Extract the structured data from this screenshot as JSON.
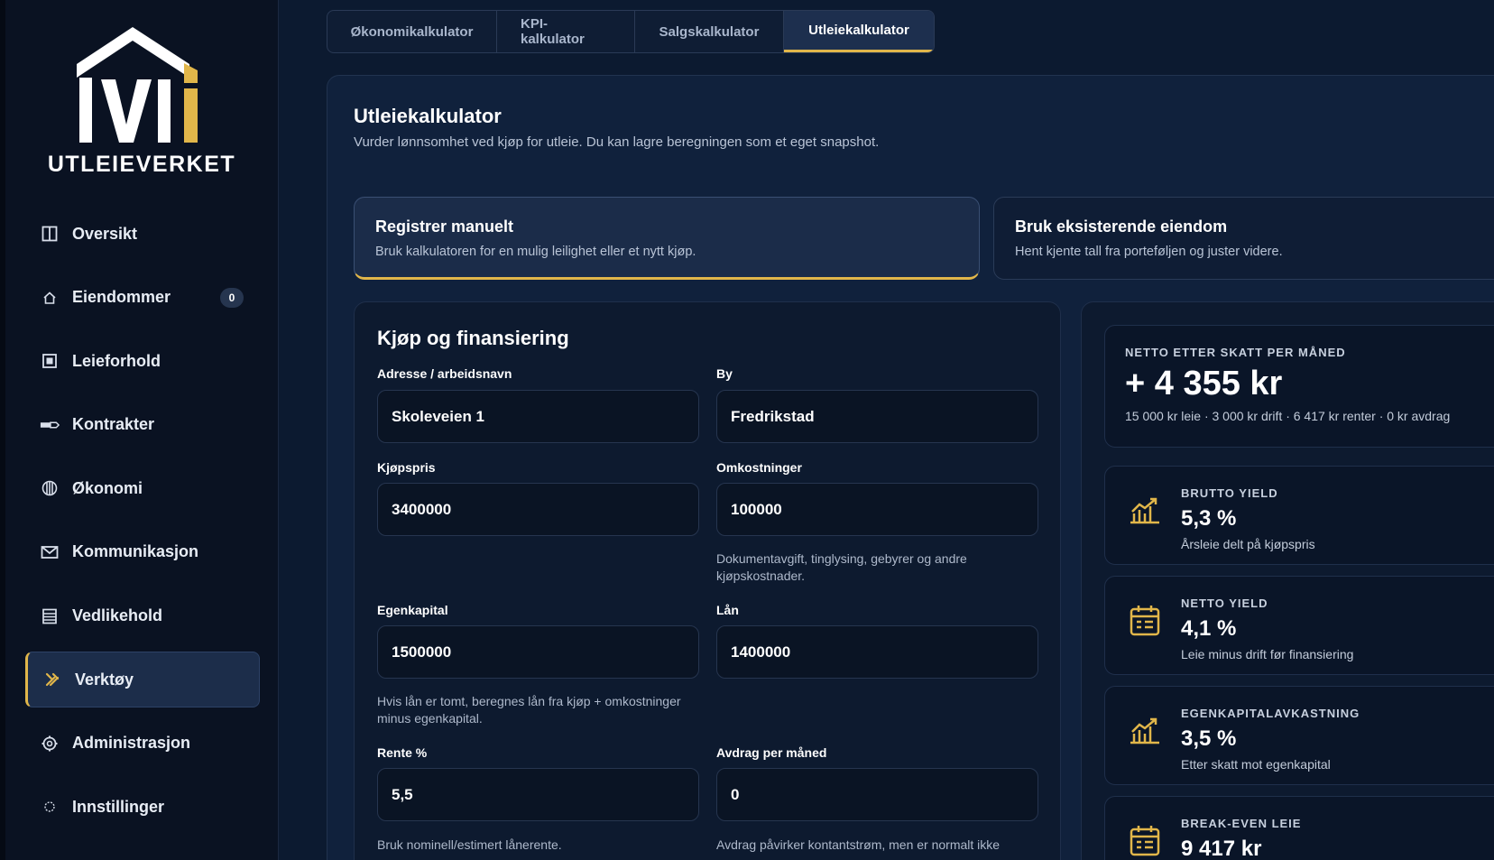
{
  "brand": {
    "name": "UTLEIEVERKET",
    "accent": "#e1b64a"
  },
  "sidebar": {
    "items": [
      {
        "label": "Oversikt",
        "icon": "columns-icon"
      },
      {
        "label": "Eiendommer",
        "icon": "home-icon",
        "badge": "0"
      },
      {
        "label": "Leieforhold",
        "icon": "square-icon"
      },
      {
        "label": "Kontrakter",
        "icon": "pen-icon"
      },
      {
        "label": "Økonomi",
        "icon": "globe-icon"
      },
      {
        "label": "Kommunikasjon",
        "icon": "mail-icon"
      },
      {
        "label": "Vedlikehold",
        "icon": "list-icon"
      },
      {
        "label": "Verktøy",
        "icon": "hammer-icon",
        "active": true
      },
      {
        "label": "Administrasjon",
        "icon": "gear-icon"
      },
      {
        "label": "Innstillinger",
        "icon": "circle-icon"
      }
    ]
  },
  "tabs": [
    {
      "label": "Økonomikalkulator"
    },
    {
      "label": "KPI-kalkulator"
    },
    {
      "label": "Salgskalkulator"
    },
    {
      "label": "Utleiekalkulator",
      "active": true
    }
  ],
  "main": {
    "title": "Utleiekalkulator",
    "subtitle": "Vurder lønnsomhet ved kjøp for utleie. Du kan lagre beregningen som et eget snapshot.",
    "modes": [
      {
        "title": "Registrer manuelt",
        "desc": "Bruk kalkulatoren for en mulig leilighet eller et nytt kjøp.",
        "selected": true
      },
      {
        "title": "Bruk eksisterende eiendom",
        "desc": "Hent kjente tall fra porteføljen og juster videre."
      }
    ]
  },
  "form": {
    "title": "Kjøp og finansiering",
    "address": {
      "label": "Adresse / arbeidsnavn",
      "value": "Skoleveien 1"
    },
    "city": {
      "label": "By",
      "value": "Fredrikstad"
    },
    "price": {
      "label": "Kjøpspris",
      "value": "3400000"
    },
    "costs": {
      "label": "Omkostninger",
      "value": "100000",
      "hint": "Dokumentavgift, tinglysing, gebyrer og andre kjøpskostnader."
    },
    "equity": {
      "label": "Egenkapital",
      "value": "1500000",
      "hint": "Hvis lån er tomt, beregnes lån fra kjøp + omkostninger minus egenkapital."
    },
    "loan": {
      "label": "Lån",
      "value": "1400000"
    },
    "rate": {
      "label": "Rente %",
      "value": "5,5",
      "hint": "Bruk nominell/estimert lånerente."
    },
    "installment": {
      "label": "Avdrag per måned",
      "value": "0",
      "hint": "Avdrag påvirker kontantstrøm, men er normalt ikke"
    }
  },
  "results": {
    "net": {
      "kicker": "NETTO ETTER SKATT PER MÅNED",
      "value": "+ 4 355 kr",
      "detail": "15 000 kr leie · 3 000 kr drift · 6 417 kr renter · 0 kr avdrag"
    },
    "metrics": [
      {
        "kicker": "BRUTTO YIELD",
        "value": "5,3 %",
        "desc": "Årsleie delt på kjøpspris",
        "icon": "chart-icon"
      },
      {
        "kicker": "NETTO YIELD",
        "value": "4,1 %",
        "desc": "Leie minus drift før finansiering",
        "icon": "calendar-icon"
      },
      {
        "kicker": "EGENKAPITALAVKASTNING",
        "value": "3,5 %",
        "desc": "Etter skatt mot egenkapital",
        "icon": "chart-icon"
      },
      {
        "kicker": "BREAK-EVEN LEIE",
        "value": "9 417 kr",
        "desc": "",
        "icon": "calendar-icon"
      }
    ]
  }
}
